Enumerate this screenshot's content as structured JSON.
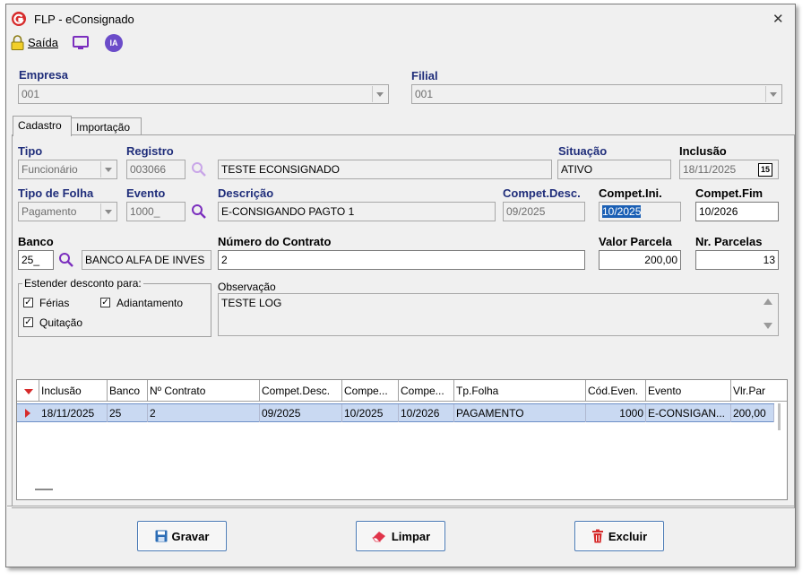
{
  "window": {
    "title": "FLP - eConsignado",
    "close": "✕"
  },
  "toolbar": {
    "saida": "Saída",
    "ia": "IA"
  },
  "empresa": {
    "label": "Empresa",
    "value": "001"
  },
  "filial": {
    "label": "Filial",
    "value": "001"
  },
  "tabs": [
    {
      "label": "Cadastro"
    },
    {
      "label": "Importação"
    }
  ],
  "form": {
    "tipo": {
      "label": "Tipo",
      "value": "Funcionário"
    },
    "registro": {
      "label": "Registro",
      "value": "003066",
      "name": "TESTE ECONSIGNADO"
    },
    "situacao": {
      "label": "Situação",
      "value": "ATIVO"
    },
    "inclusao": {
      "label": "Inclusão",
      "value": "18/11/2025",
      "cal": "15"
    },
    "tipo_folha": {
      "label": "Tipo de Folha",
      "value": "Pagamento"
    },
    "evento": {
      "label": "Evento",
      "value": "1000_"
    },
    "descricao": {
      "label": "Descrição",
      "value": "E-CONSIGANDO PAGTO 1"
    },
    "compet_desc": {
      "label": "Compet.Desc.",
      "value": "09/2025"
    },
    "compet_ini": {
      "label": "Compet.Ini.",
      "value": "10/2025"
    },
    "compet_fim": {
      "label": "Compet.Fim",
      "value": "10/2026"
    },
    "banco": {
      "label": "Banco",
      "value": "25_",
      "name": "BANCO ALFA DE INVES"
    },
    "numero_contrato": {
      "label": "Número do Contrato",
      "value": "2"
    },
    "valor_parcela": {
      "label": "Valor Parcela",
      "value": "200,00"
    },
    "nr_parcelas": {
      "label": "Nr. Parcelas",
      "value": "13"
    },
    "estender": {
      "label": "Estender desconto para:",
      "ferias": "Férias",
      "adiantamento": "Adiantamento",
      "quitacao": "Quitação"
    },
    "observacao": {
      "label": "Observação",
      "value": "TESTE LOG"
    }
  },
  "grid": {
    "headers": [
      "Inclusão",
      "Banco",
      "Nº Contrato",
      "Compet.Desc.",
      "Compe...",
      "Compe...",
      "Tp.Folha",
      "Cód.Even.",
      "Evento",
      "Vlr.Par"
    ],
    "rows": [
      [
        "18/11/2025",
        "25",
        "2",
        "09/2025",
        "10/2025",
        "10/2026",
        "PAGAMENTO",
        "1000",
        "E-CONSIGAN...",
        "200,00"
      ]
    ]
  },
  "buttons": {
    "gravar": "Gravar",
    "limpar": "Limpar",
    "excluir": "Excluir"
  },
  "colors": {
    "label_blue": "#1f2d7a",
    "selected_row": "#c9d9f2",
    "accent_purple": "#7b2fbe"
  }
}
